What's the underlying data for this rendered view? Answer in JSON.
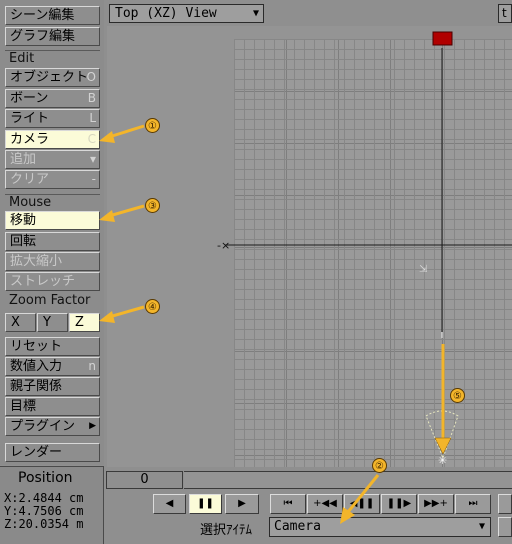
{
  "view": {
    "mode": "Top (XZ) View",
    "corner_label": "t"
  },
  "sidebar": {
    "scene_editor": "シーン編集",
    "graph_editor": "グラフ編集",
    "edit_section": "Edit",
    "objects": {
      "label": "オブジェクト",
      "shortcut": "O"
    },
    "bones": {
      "label": "ボーン",
      "shortcut": "B"
    },
    "lights": {
      "label": "ライト",
      "shortcut": "L"
    },
    "camera": {
      "label": "カメラ",
      "shortcut": "C"
    },
    "add": {
      "label": "追加",
      "shortcut": "▾"
    },
    "clear": {
      "label": "クリア",
      "shortcut": "-"
    },
    "mouse_section": "Mouse",
    "move": "移動",
    "rotate": "回転",
    "scale": "拡大縮小",
    "stretch": "ストレッチ",
    "zoom_factor": "Zoom Factor",
    "axis_x": "X",
    "axis_y": "Y",
    "axis_z": "Z",
    "reset": "リセット",
    "numeric": {
      "label": "数値入力",
      "shortcut": "n"
    },
    "parent": "親子関係",
    "target": "目標",
    "plugins": "プラグイン",
    "render": "レンダー"
  },
  "position": {
    "title": "Position",
    "x": "X:2.4844 cm",
    "y": "Y:4.7506 cm",
    "z": "Z:20.0354 m"
  },
  "timeline": {
    "frame": "0"
  },
  "transport": {
    "play_back": "◀",
    "pause": "❚❚",
    "play": "▶",
    "first": "⏮",
    "prev_key": "+◀◀",
    "prev_frame": "◀❚❚",
    "next_frame": "❚❚▶",
    "next_key": "▶▶+",
    "last": "⏭"
  },
  "selection": {
    "label": "選択ｱｲﾃﾑ",
    "value": "Camera"
  },
  "callouts": [
    "①",
    "②",
    "③",
    "④",
    "⑤"
  ],
  "colors": {
    "active_button": "#fbfbd8",
    "arrow": "#f3b52a",
    "light_marker": "#b00000"
  }
}
